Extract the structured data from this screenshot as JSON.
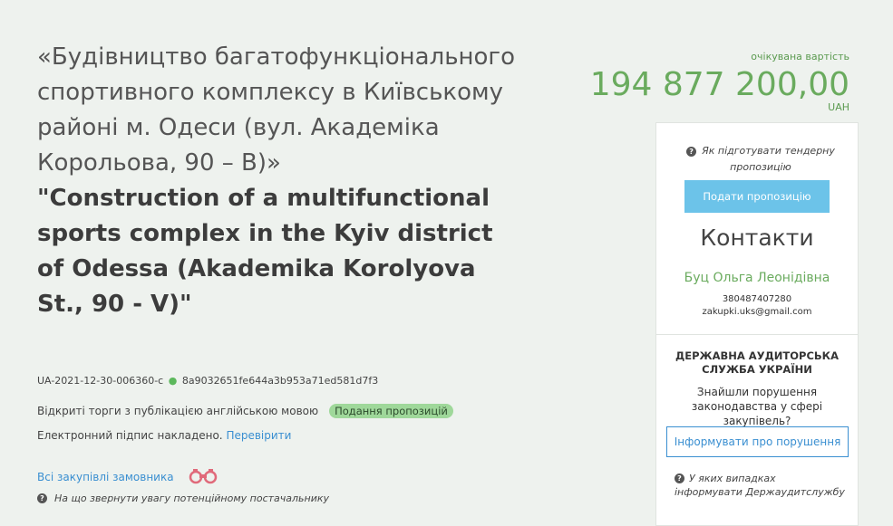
{
  "tender": {
    "title_ua": "«Будівництво багатофункціонального спортивного комплексу в Київському районі м. Одеси (вул. Академіка Корольова, 90 – В)»",
    "title_en": "\"Construction of a multifunctional sports complex in the Kyiv district of Odessa (Akademika Korolyova St., 90 - V)\"",
    "id": "UA-2021-12-30-006360-c",
    "hash": "8a9032651fe644a3b953a71ed581d7f3",
    "procedure": "Відкриті торги з публікацією англійською мовою",
    "status_badge": "Подання пропозицій",
    "signature_text": "Електронний підпис накладено.",
    "signature_check": "Перевірити",
    "all_purchases": "Всі закупівлі замовника",
    "attention_hint": "На що звернути увагу потенційному постачальнику"
  },
  "price": {
    "label": "очікувана вартість",
    "amount": "194 877 200,00",
    "currency": "UAH"
  },
  "offer_panel": {
    "how_to_hint": "Як підготувати тендерну пропозицію",
    "submit_label": "Подати пропозицію",
    "contacts_title": "Контакти",
    "contact_name": "Буц Ольга Леонідівна",
    "contact_phone": "380487407280",
    "contact_email": "zakupki.uks@gmail.com"
  },
  "audit_panel": {
    "title": "ДЕРЖАВНА АУДИТОРСЬКА СЛУЖБА УКРАЇНИ",
    "text": "Знайшли порушення законодавства у сфері закупівель?",
    "report_label": "Інформувати про порушення",
    "hint": "У яких випадках інформувати Держаудитслужбу"
  },
  "colors": {
    "accent_green": "#6aab5e",
    "link_blue": "#3a8fd1",
    "button_blue": "#6cc3e9",
    "badge_green": "#9fd89a"
  },
  "icons": {
    "question": "question-circle-icon",
    "binoculars": "binoculars-icon",
    "dot": "status-dot-icon"
  }
}
